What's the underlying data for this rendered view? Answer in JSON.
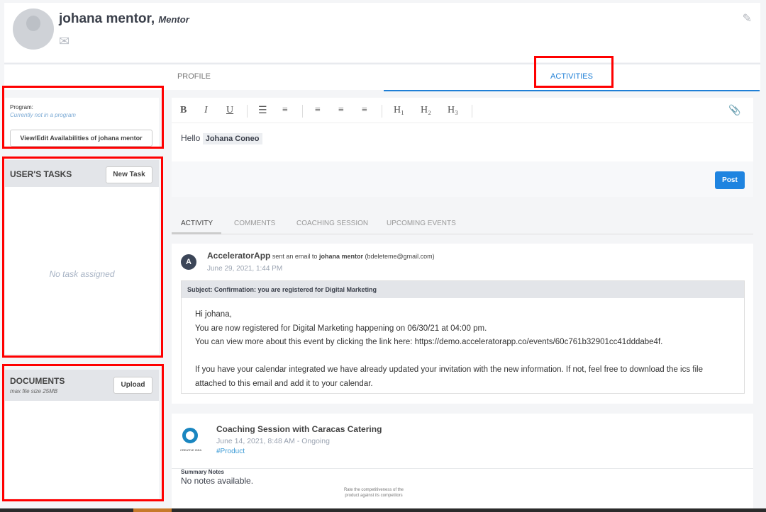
{
  "profile": {
    "name": "johana mentor,",
    "role": "Mentor"
  },
  "tabs": [
    {
      "label": "PROFILE"
    },
    {
      "label": "ACTIVITIES"
    }
  ],
  "program": {
    "label": "Program:",
    "value": "Currently not in a program",
    "button": "View/Edit Availabilities of johana mentor"
  },
  "tasks": {
    "title": "USER'S TASKS",
    "button": "New Task",
    "empty": "No task assigned"
  },
  "documents": {
    "title": "DOCUMENTS",
    "subtitle": "max file size 25MB",
    "button": "Upload"
  },
  "editor": {
    "toolbar": [
      "B",
      "I",
      "U",
      "☰",
      "≡",
      "≡",
      "≡",
      "≡",
      "H₁",
      "H₂",
      "H₃"
    ],
    "greeting": "Hello",
    "mention": "Johana Coneo",
    "post": "Post"
  },
  "activity_tabs": [
    "ACTIVITY",
    "COMMENTS",
    "COACHING SESSION",
    "UPCOMING EVENTS"
  ],
  "email": {
    "avatar": "A",
    "sender": "AcceleratorApp",
    "action": "sent an email to",
    "recipient": "johana mentor",
    "address": "(bdeleteme@gmail.com)",
    "date": "June 29, 2021, 1:44 PM",
    "subject": "Subject: Confirmation: you are registered for Digital Marketing",
    "lines": [
      "Hi johana,",
      "You are now registered for Digital Marketing happening on 06/30/21 at 04:00 pm.",
      "You can view more about this event by clicking the link here: https://demo.acceleratorapp.co/events/60c761b32901cc41dddabe4f.",
      "",
      "If you have your calendar integrated we have already updated your invitation with the new information. If not, feel free to download the ics file",
      "attached to this email and add it to your calendar."
    ]
  },
  "session": {
    "title": "Coaching Session with Caracas Catering",
    "date": "June 14, 2021, 8:48 AM - Ongoing",
    "tag": "#Product",
    "logo_text": "CREATIVE IDEA",
    "notes_label": "Summary Notes",
    "notes": "No notes available.",
    "image_text": "Rate the competitiveness of the product against its competitors"
  }
}
